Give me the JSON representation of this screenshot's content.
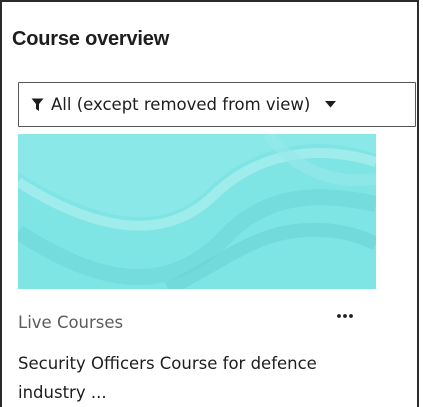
{
  "block": {
    "title": "Course overview"
  },
  "filter": {
    "icon": "filter-icon",
    "label": "All (except removed from view)",
    "caret_icon": "caret-down-icon"
  },
  "course": {
    "category": "Live Courses",
    "name": "Security Officers Course for defence industry ...",
    "menu_icon": "more-options-icon",
    "image_color": "#7fe4e4"
  },
  "colors": {
    "image_base": "#7fe4e4",
    "image_wave_light": "#9aeaea",
    "image_wave_dark": "#6ed6d6",
    "border": "#2b2b2b"
  }
}
